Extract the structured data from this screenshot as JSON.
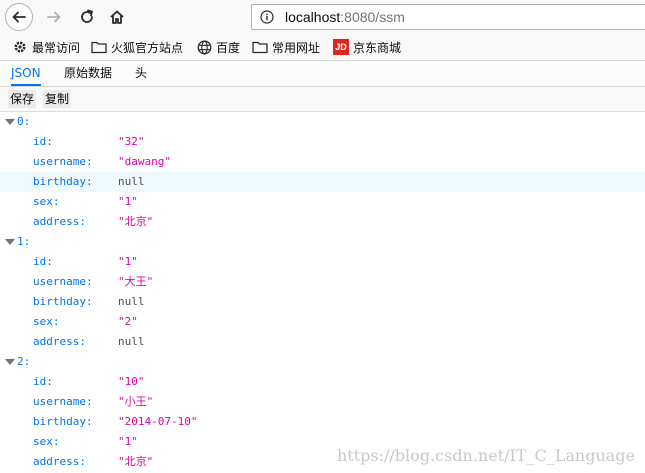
{
  "browser": {
    "url_host": "localhost",
    "url_path": ":8080/ssm"
  },
  "bookmarks": [
    {
      "label": "最常访问",
      "icon": "gear-icon"
    },
    {
      "label": "火狐官方站点",
      "icon": "folder-icon"
    },
    {
      "label": "百度",
      "icon": "globe-icon"
    },
    {
      "label": "常用网址",
      "icon": "folder-icon"
    },
    {
      "label": "京东商城",
      "icon": "jd-logo-icon",
      "icon_text": "JD"
    }
  ],
  "viewer_tabs": [
    "JSON",
    "原始数据",
    "头"
  ],
  "toolbar_buttons": [
    "保存",
    "复制"
  ],
  "records": [
    {
      "index_label": "0:",
      "fields": [
        {
          "key": "id:",
          "value": "\"32\"",
          "type": "string"
        },
        {
          "key": "username:",
          "value": "\"dawang\"",
          "type": "string"
        },
        {
          "key": "birthday:",
          "value": "null",
          "type": "null"
        },
        {
          "key": "sex:",
          "value": "\"1\"",
          "type": "string"
        },
        {
          "key": "address:",
          "value": "\"北京\"",
          "type": "string"
        }
      ]
    },
    {
      "index_label": "1:",
      "fields": [
        {
          "key": "id:",
          "value": "\"1\"",
          "type": "string"
        },
        {
          "key": "username:",
          "value": "\"大王\"",
          "type": "string"
        },
        {
          "key": "birthday:",
          "value": "null",
          "type": "null"
        },
        {
          "key": "sex:",
          "value": "\"2\"",
          "type": "string"
        },
        {
          "key": "address:",
          "value": "null",
          "type": "null"
        }
      ]
    },
    {
      "index_label": "2:",
      "fields": [
        {
          "key": "id:",
          "value": "\"10\"",
          "type": "string"
        },
        {
          "key": "username:",
          "value": "\"小王\"",
          "type": "string"
        },
        {
          "key": "birthday:",
          "value": "\"2014-07-10\"",
          "type": "string"
        },
        {
          "key": "sex:",
          "value": "\"1\"",
          "type": "string"
        },
        {
          "key": "address:",
          "value": "\"北京\"",
          "type": "string"
        }
      ]
    }
  ],
  "watermark": "https://blog.csdn.net/IT_C_Language",
  "colors": {
    "key": "#0074e8",
    "string": "#dd00a9",
    "null": "#4d4d4d",
    "active_tab": "#0074e8",
    "hover_row": "#f0f9fe"
  }
}
